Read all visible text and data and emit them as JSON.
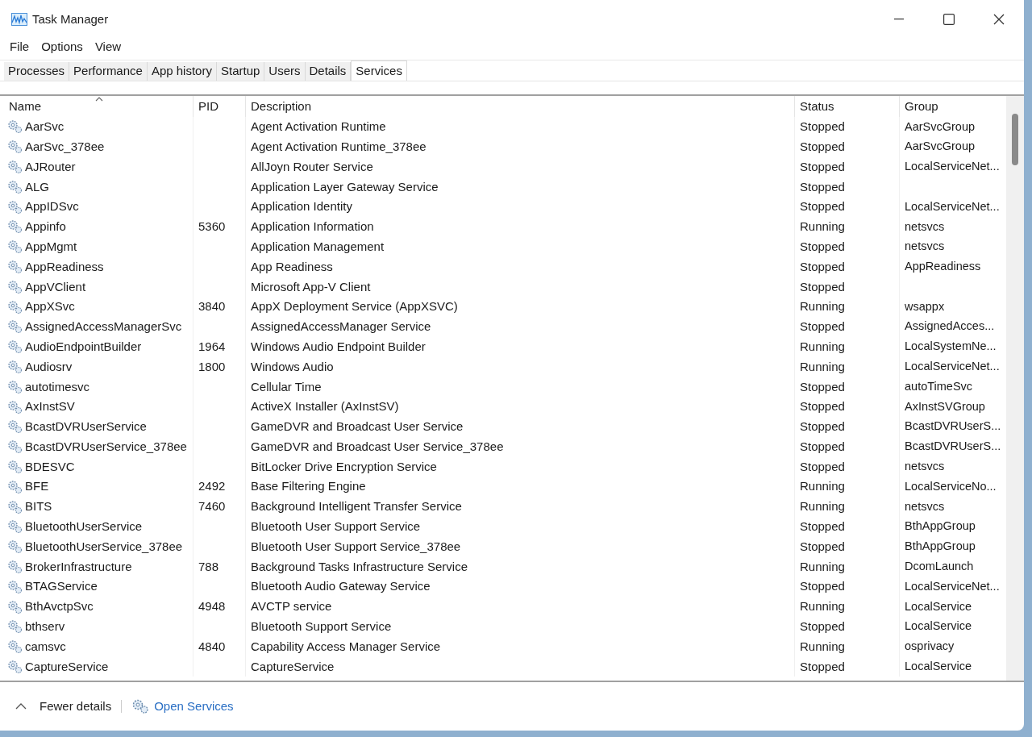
{
  "window": {
    "title": "Task Manager"
  },
  "menu": [
    "File",
    "Options",
    "View"
  ],
  "tabs": [
    {
      "label": "Processes",
      "selected": false
    },
    {
      "label": "Performance",
      "selected": false
    },
    {
      "label": "App history",
      "selected": false
    },
    {
      "label": "Startup",
      "selected": false
    },
    {
      "label": "Users",
      "selected": false
    },
    {
      "label": "Details",
      "selected": false
    },
    {
      "label": "Services",
      "selected": true
    }
  ],
  "table": {
    "columns": [
      "Name",
      "PID",
      "Description",
      "Status",
      "Group"
    ],
    "rows": [
      [
        "AarSvc",
        "",
        "Agent Activation Runtime",
        "Stopped",
        "AarSvcGroup"
      ],
      [
        "AarSvc_378ee",
        "",
        "Agent Activation Runtime_378ee",
        "Stopped",
        "AarSvcGroup"
      ],
      [
        "AJRouter",
        "",
        "AllJoyn Router Service",
        "Stopped",
        "LocalServiceNet..."
      ],
      [
        "ALG",
        "",
        "Application Layer Gateway Service",
        "Stopped",
        ""
      ],
      [
        "AppIDSvc",
        "",
        "Application Identity",
        "Stopped",
        "LocalServiceNet..."
      ],
      [
        "Appinfo",
        "5360",
        "Application Information",
        "Running",
        "netsvcs"
      ],
      [
        "AppMgmt",
        "",
        "Application Management",
        "Stopped",
        "netsvcs"
      ],
      [
        "AppReadiness",
        "",
        "App Readiness",
        "Stopped",
        "AppReadiness"
      ],
      [
        "AppVClient",
        "",
        "Microsoft App-V Client",
        "Stopped",
        ""
      ],
      [
        "AppXSvc",
        "3840",
        "AppX Deployment Service (AppXSVC)",
        "Running",
        "wsappx"
      ],
      [
        "AssignedAccessManagerSvc",
        "",
        "AssignedAccessManager Service",
        "Stopped",
        "AssignedAcces..."
      ],
      [
        "AudioEndpointBuilder",
        "1964",
        "Windows Audio Endpoint Builder",
        "Running",
        "LocalSystemNe..."
      ],
      [
        "Audiosrv",
        "1800",
        "Windows Audio",
        "Running",
        "LocalServiceNet..."
      ],
      [
        "autotimesvc",
        "",
        "Cellular Time",
        "Stopped",
        "autoTimeSvc"
      ],
      [
        "AxInstSV",
        "",
        "ActiveX Installer (AxInstSV)",
        "Stopped",
        "AxInstSVGroup"
      ],
      [
        "BcastDVRUserService",
        "",
        "GameDVR and Broadcast User Service",
        "Stopped",
        "BcastDVRUserS..."
      ],
      [
        "BcastDVRUserService_378ee",
        "",
        "GameDVR and Broadcast User Service_378ee",
        "Stopped",
        "BcastDVRUserS..."
      ],
      [
        "BDESVC",
        "",
        "BitLocker Drive Encryption Service",
        "Stopped",
        "netsvcs"
      ],
      [
        "BFE",
        "2492",
        "Base Filtering Engine",
        "Running",
        "LocalServiceNo..."
      ],
      [
        "BITS",
        "7460",
        "Background Intelligent Transfer Service",
        "Running",
        "netsvcs"
      ],
      [
        "BluetoothUserService",
        "",
        "Bluetooth User Support Service",
        "Stopped",
        "BthAppGroup"
      ],
      [
        "BluetoothUserService_378ee",
        "",
        "Bluetooth User Support Service_378ee",
        "Stopped",
        "BthAppGroup"
      ],
      [
        "BrokerInfrastructure",
        "788",
        "Background Tasks Infrastructure Service",
        "Running",
        "DcomLaunch"
      ],
      [
        "BTAGService",
        "",
        "Bluetooth Audio Gateway Service",
        "Stopped",
        "LocalServiceNet..."
      ],
      [
        "BthAvctpSvc",
        "4948",
        "AVCTP service",
        "Running",
        "LocalService"
      ],
      [
        "bthserv",
        "",
        "Bluetooth Support Service",
        "Stopped",
        "LocalService"
      ],
      [
        "camsvc",
        "4840",
        "Capability Access Manager Service",
        "Running",
        "osprivacy"
      ],
      [
        "CaptureService",
        "",
        "CaptureService",
        "Stopped",
        "LocalService"
      ]
    ]
  },
  "footer": {
    "fewer_details": "Fewer details",
    "open_services": "Open Services"
  }
}
